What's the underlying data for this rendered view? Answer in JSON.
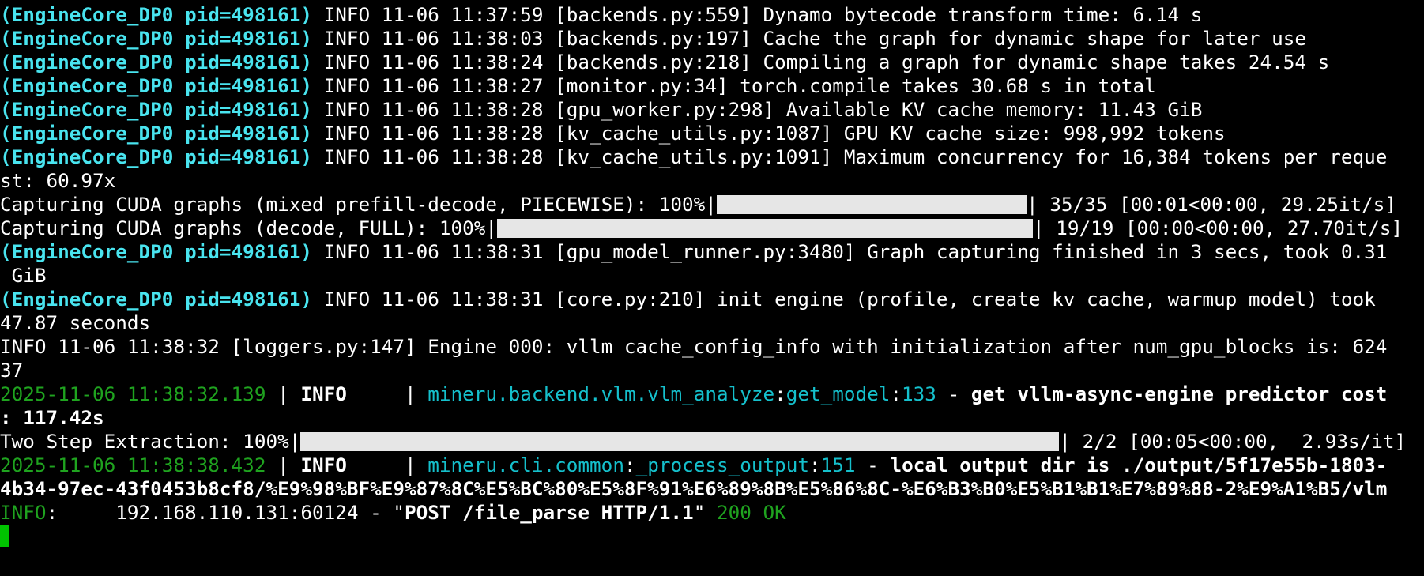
{
  "colors": {
    "background": "#000000",
    "pid": "#49e4ef",
    "text": "#ffffff",
    "timestamp_green": "#1fa31f",
    "module_cyan": "#15c0cc",
    "progress_fill": "#e6e6e6",
    "cursor": "#00c400"
  },
  "lines": [
    {
      "pid": "(EngineCore_DP0 pid=498161)",
      "msg": " INFO 11-06 11:37:59 [backends.py:559] Dynamo bytecode transform time: 6.14 s"
    },
    {
      "pid": "(EngineCore_DP0 pid=498161)",
      "msg": " INFO 11-06 11:38:03 [backends.py:197] Cache the graph for dynamic shape for later use"
    },
    {
      "pid": "(EngineCore_DP0 pid=498161)",
      "msg": " INFO 11-06 11:38:24 [backends.py:218] Compiling a graph for dynamic shape takes 24.54 s"
    },
    {
      "pid": "(EngineCore_DP0 pid=498161)",
      "msg": " INFO 11-06 11:38:27 [monitor.py:34] torch.compile takes 30.68 s in total"
    },
    {
      "pid": "(EngineCore_DP0 pid=498161)",
      "msg": " INFO 11-06 11:38:28 [gpu_worker.py:298] Available KV cache memory: 11.43 GiB"
    },
    {
      "pid": "(EngineCore_DP0 pid=498161)",
      "msg": " INFO 11-06 11:38:28 [kv_cache_utils.py:1087] GPU KV cache size: 998,992 tokens"
    },
    {
      "pid": "(EngineCore_DP0 pid=498161)",
      "msg": " INFO 11-06 11:38:28 [kv_cache_utils.py:1091] Maximum concurrency for 16,384 tokens per reque"
    },
    {
      "msg": "st: 60.97x"
    },
    {
      "pid": "(EngineCore_DP0 pid=498161)",
      "msg": " INFO 11-06 11:38:31 [gpu_model_runner.py:3480] Graph capturing finished in 3 secs, took 0.31"
    },
    {
      "msg": " GiB"
    },
    {
      "pid": "(EngineCore_DP0 pid=498161)",
      "msg": " INFO 11-06 11:38:31 [core.py:210] init engine (profile, create kv cache, warmup model) took"
    },
    {
      "msg": "47.87 seconds"
    },
    {
      "msg": "INFO 11-06 11:38:32 [loggers.py:147] Engine 000: vllm cache_config_info with initialization after num_gpu_blocks is: 624"
    },
    {
      "msg": "37"
    }
  ],
  "progress": [
    {
      "prefix": "Capturing CUDA graphs (mixed prefill-decode, PIECEWISE): 100%|",
      "suffix": "| 35/35 [00:01<00:00, 29.25it/s]",
      "percent": 100
    },
    {
      "prefix": "Capturing CUDA graphs (decode, FULL): 100%|",
      "suffix": "| 19/19 [00:00<00:00, 27.70it/s]",
      "percent": 100
    },
    {
      "prefix": "Two Step Extraction: 100%|",
      "suffix": "| 2/2 [00:05<00:00,  2.93s/it]",
      "percent": 100
    }
  ],
  "mineru": [
    {
      "timestamp": "2025-11-06 11:38:32.139",
      "sep1": " | ",
      "level": "INFO    ",
      "sep2": " | ",
      "module": "mineru.backend.vlm.vlm_analyze",
      "colon1": ":",
      "func": "get_model",
      "colon2": ":",
      "lineno": "133",
      "dash": " - ",
      "message": "get vllm-async-engine predictor cost",
      "cont": ": 117.42s"
    },
    {
      "timestamp": "2025-11-06 11:38:38.432",
      "sep1": " | ",
      "level": "INFO    ",
      "sep2": " | ",
      "module": "mineru.cli.common",
      "colon1": ":",
      "func": "_process_output",
      "colon2": ":",
      "lineno": "151",
      "dash": " - ",
      "message": "local output dir is ./output/5f17e55b-1803-",
      "cont": "4b34-97ec-43f0453b8cf8/%E9%98%BF%E9%87%8C%E5%BC%80%E5%8F%91%E6%89%8B%E5%86%8C-%E6%B3%B0%E5%B1%B1%E7%89%88-2%E9%A1%B5/vlm"
    }
  ],
  "access": {
    "level": "INFO",
    "pad": ":     192.168.110.131:60124 - \"",
    "request": "POST /file_parse HTTP/1.1",
    "quote": "\" ",
    "status": "200 OK"
  }
}
